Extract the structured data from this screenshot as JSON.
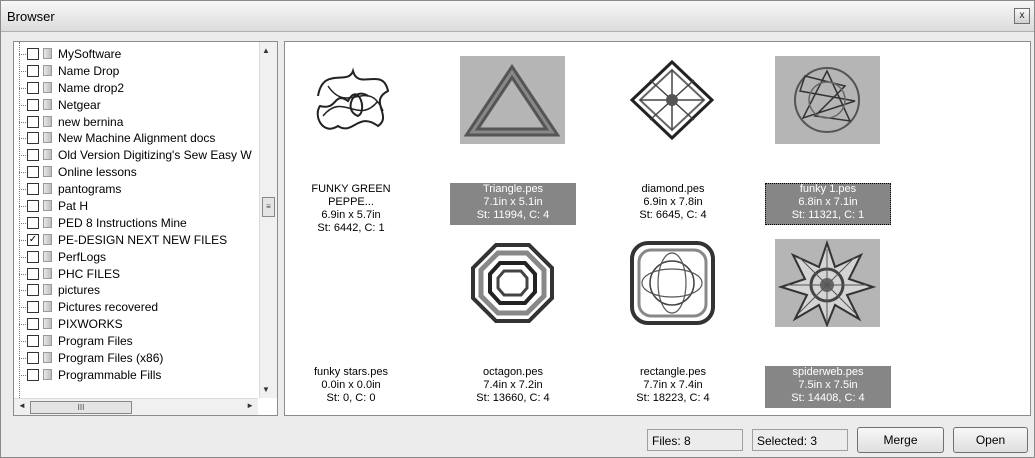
{
  "window": {
    "title": "Browser",
    "close_glyph": "x"
  },
  "tree": {
    "items": [
      {
        "label": "MySoftware",
        "checked": false
      },
      {
        "label": "Name Drop",
        "checked": false
      },
      {
        "label": "Name drop2",
        "checked": false
      },
      {
        "label": "Netgear",
        "checked": false
      },
      {
        "label": "new bernina",
        "checked": false
      },
      {
        "label": "New Machine Alignment docs",
        "checked": false
      },
      {
        "label": "Old Version Digitizing's Sew Easy W",
        "checked": false
      },
      {
        "label": "Online lessons",
        "checked": false
      },
      {
        "label": "pantograms",
        "checked": false
      },
      {
        "label": "Pat H",
        "checked": false
      },
      {
        "label": "PED 8 Instructions Mine",
        "checked": false
      },
      {
        "label": "PE-DESIGN NEXT NEW FILES",
        "checked": true
      },
      {
        "label": "PerfLogs",
        "checked": false
      },
      {
        "label": "PHC FILES",
        "checked": false
      },
      {
        "label": "pictures",
        "checked": false
      },
      {
        "label": "Pictures recovered",
        "checked": false
      },
      {
        "label": "PIXWORKS",
        "checked": false
      },
      {
        "label": "Program Files",
        "checked": false
      },
      {
        "label": "Program Files (x86)",
        "checked": false
      },
      {
        "label": "Programmable Fills",
        "checked": false
      }
    ],
    "scroll_up": "▲",
    "scroll_down": "▼",
    "scroll_left": "◄",
    "scroll_right": "►",
    "vthumb_grip": "≡",
    "hthumb_grip": "III"
  },
  "gallery": {
    "items": [
      {
        "name": "FUNKY GREEN PEPPE...",
        "size": "6.9in x 5.7in",
        "stats": "St: 6442, C: 1",
        "selected": false,
        "thumb": "scribble-icon"
      },
      {
        "name": "Triangle.pes",
        "size": "7.1in x 5.1in",
        "stats": "St: 11994, C: 4",
        "selected": true,
        "thumb": "triangle-icon"
      },
      {
        "name": "diamond.pes",
        "size": "6.9in x 7.8in",
        "stats": "St: 6645, C: 4",
        "selected": false,
        "thumb": "diamond-icon"
      },
      {
        "name": "funky 1.pes",
        "size": "6.8in x 7.1in",
        "stats": "St: 11321, C: 1",
        "selected": true,
        "thumb": "funky-knot-icon"
      },
      {
        "name": "funky stars.pes",
        "size": "0.0in x 0.0in",
        "stats": "St: 0, C: 0",
        "selected": false,
        "thumb": "empty-icon"
      },
      {
        "name": "octagon.pes",
        "size": "7.4in x 7.2in",
        "stats": "St: 13660, C: 4",
        "selected": false,
        "thumb": "octagon-icon"
      },
      {
        "name": "rectangle.pes",
        "size": "7.7in x 7.4in",
        "stats": "St: 18223, C: 4",
        "selected": false,
        "thumb": "rounded-rectangle-icon"
      },
      {
        "name": "spiderweb.pes",
        "size": "7.5in x 7.5in",
        "stats": "St: 14408, C: 4",
        "selected": true,
        "thumb": "spiderweb-icon"
      }
    ]
  },
  "status": {
    "files": "Files: 8",
    "selected": "Selected: 3"
  },
  "buttons": {
    "merge": "Merge",
    "open": "Open"
  },
  "colors": {
    "selection": "#868686",
    "thumb_bg": "#b5b5b5"
  }
}
